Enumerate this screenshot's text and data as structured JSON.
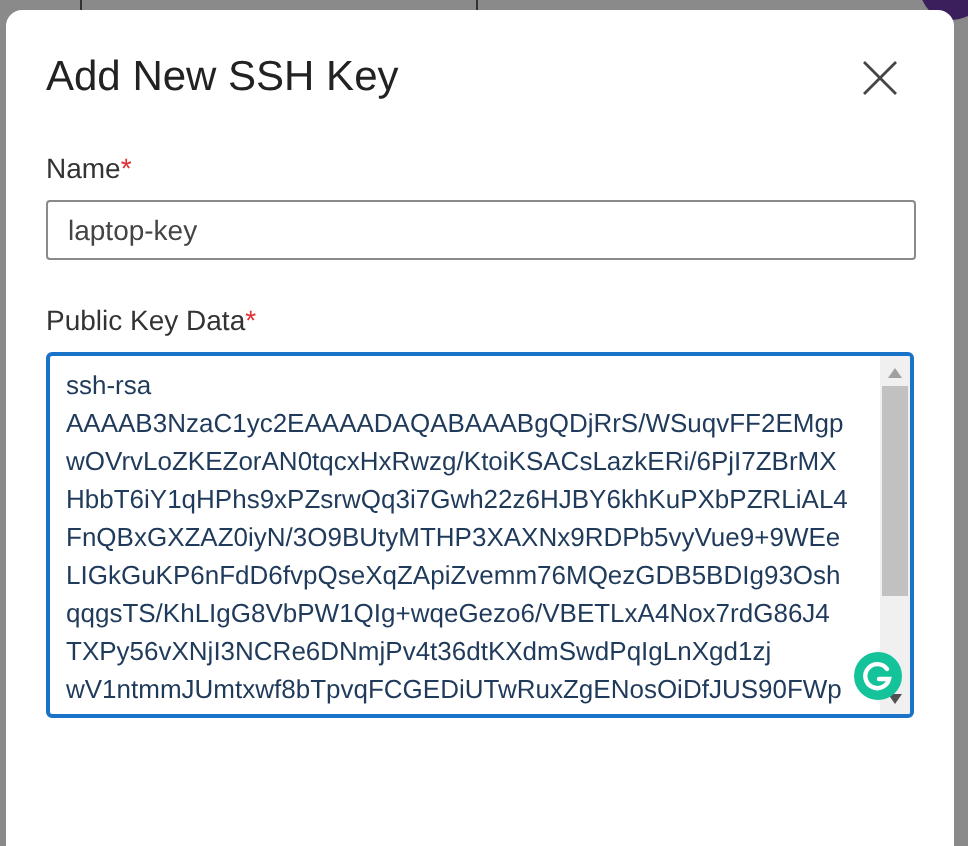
{
  "dialog": {
    "title": "Add New SSH Key",
    "fields": [
      {
        "kind": "input",
        "label": "Name",
        "required_mark": "*",
        "value": "laptop-key"
      },
      {
        "kind": "textarea",
        "label": "Public Key Data",
        "required_mark": "*",
        "lines": [
          "ssh-rsa",
          "AAAAB3NzaC1yc2EAAAADAQABAAABgQDjRrS/WSuqvFF2EMgp",
          "wOVrvLoZKEZorAN0tqcxHxRwzg/KtoiKSACsLazkERi/6PjI7ZBrMX",
          "HbbT6iY1qHPhs9xPZsrwQq3i7Gwh22z6HJBY6khKuPXbPZRLiAL4",
          "FnQBxGXZAZ0iyN/3O9BUtyMTHP3XAXNx9RDPb5vyVue9+9WEe",
          "LIGkGuKP6nFdD6fvpQseXqZApiZvemm76MQezGDB5BDIg93Osh",
          "qqgsTS/KhLIgG8VbPW1QIg+wqeGezo6/VBETLxA4Nox7rdG86J4",
          "TXPy56vXNjI3NCRe6DNmjPv4t36dtKXdmSwdPqIgLnXgd1zj",
          "wV1ntmmJUmtxwf8bTpvqFCGEDiUTwRuxZgENosOiDfJUS90FWp"
        ]
      }
    ]
  }
}
